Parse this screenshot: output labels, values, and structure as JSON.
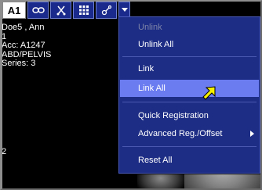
{
  "toolbar": {
    "viewport_label": "A1",
    "icons": [
      "link-chain-icon",
      "scissors-icon",
      "grid-layout-icon",
      "link-settings-icon",
      "dropdown-arrow-icon"
    ]
  },
  "patient": {
    "name": "Doe5 ,  Ann",
    "line2": "1",
    "accession": "Acc: A1247",
    "study": "ABD/PELVIS",
    "series": "Series: 3"
  },
  "stray_text": "2",
  "menu": {
    "items": [
      {
        "label": "Unlink",
        "enabled": false
      },
      {
        "label": "Unlink All",
        "enabled": true
      },
      {
        "label": "Link",
        "enabled": true
      },
      {
        "label": "Link All",
        "enabled": true,
        "highlighted": true
      },
      {
        "label": "Quick Registration",
        "enabled": true
      },
      {
        "label": "Advanced Reg./Offset",
        "enabled": true,
        "submenu": true
      },
      {
        "label": "Reset All",
        "enabled": true
      }
    ]
  },
  "colors": {
    "menu_bg": "#1d2d85",
    "menu_highlight": "#6b7cf0",
    "cursor": "#f5f000"
  }
}
